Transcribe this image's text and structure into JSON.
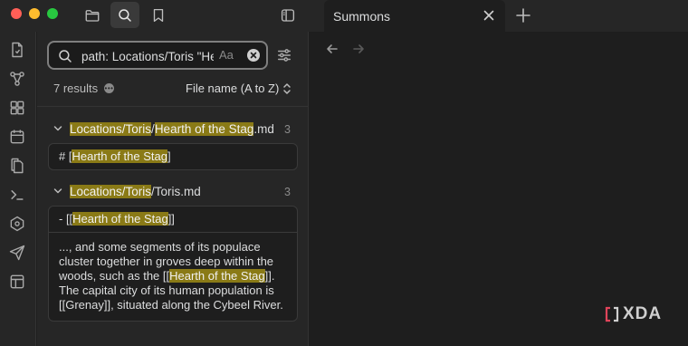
{
  "titlebar": {
    "icons": [
      "folder-icon",
      "search-icon",
      "bookmark-icon",
      "sidebar-toggle-icon"
    ]
  },
  "tab": {
    "title": "Summons"
  },
  "ribbon": {
    "icons": [
      "daily-note-icon",
      "graph-icon",
      "canvas-icon",
      "calendar-icon",
      "templates-icon",
      "terminal-icon",
      "graph-view-icon",
      "publish-icon",
      "layout-icon"
    ]
  },
  "search": {
    "value": "path: Locations/Toris \"Hearth of the Stag\"",
    "case_label": "Aa"
  },
  "results": {
    "count": "7 results",
    "sort": "File name (A to Z)"
  },
  "files": [
    {
      "title_parts": [
        {
          "text": "Locations/Toris",
          "hl": true
        },
        {
          "text": "/",
          "hl": false
        },
        {
          "text": "Hearth of the Stag",
          "hl": true
        },
        {
          "text": ".md",
          "hl": false
        }
      ],
      "count": "3",
      "matches": [
        [
          {
            "text": "# [",
            "hl": false
          },
          {
            "text": "Hearth of the Stag",
            "hl": true
          },
          {
            "text": "]",
            "hl": false
          }
        ]
      ]
    },
    {
      "title_parts": [
        {
          "text": "Locations/Toris",
          "hl": true
        },
        {
          "text": "/Toris.md",
          "hl": false
        }
      ],
      "count": "3",
      "matches": [
        [
          {
            "text": "- [[",
            "hl": false
          },
          {
            "text": "Hearth of the Stag",
            "hl": true
          },
          {
            "text": "]]",
            "hl": false
          }
        ],
        [
          {
            "text": "..., and some segments of its populace cluster together in groves deep within the woods, such as the [[",
            "hl": false
          },
          {
            "text": "Hearth of the Stag",
            "hl": true
          },
          {
            "text": "]]. The capital city of its human population is [[Grenay]], situated along the Cybeel River.",
            "hl": false
          }
        ]
      ]
    }
  ],
  "watermark": {
    "text": "XDA"
  },
  "colors": {
    "highlight": "#8a7a16",
    "background": "#1e1e1e",
    "panel": "#262626",
    "watermark_accent": "#e0445a"
  }
}
